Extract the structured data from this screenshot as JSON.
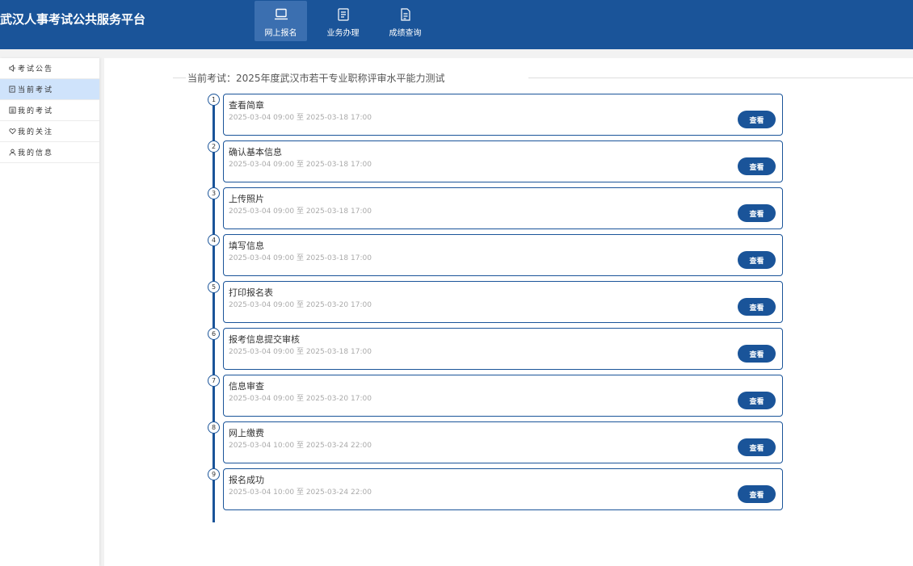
{
  "app": {
    "title": "武汉人事考试公共服务平台"
  },
  "colors": {
    "primary": "#1a5499",
    "nav_active": "#3b6fb0",
    "sidebar_active": "#cfe3fb"
  },
  "nav": [
    {
      "label": "网上报名",
      "icon": "laptop-icon",
      "active": true
    },
    {
      "label": "业务办理",
      "icon": "business-icon",
      "active": false
    },
    {
      "label": "成绩查询",
      "icon": "document-icon",
      "active": false
    }
  ],
  "sidebar": [
    {
      "label": "考试公告",
      "icon": "speaker-icon",
      "active": false
    },
    {
      "label": "当前考试",
      "icon": "edit-icon",
      "active": true
    },
    {
      "label": "我的考试",
      "icon": "list-icon",
      "active": false
    },
    {
      "label": "我的关注",
      "icon": "heart-icon",
      "active": false
    },
    {
      "label": "我的信息",
      "icon": "user-icon",
      "active": false
    }
  ],
  "exam": {
    "title": "当前考试：2025年度武汉市若干专业职称评审水平能力测试"
  },
  "steps": [
    {
      "num": "1",
      "name": "查看简章",
      "time": "2025-03-04 09:00 至 2025-03-18 17:00",
      "button": "查看"
    },
    {
      "num": "2",
      "name": "确认基本信息",
      "time": "2025-03-04 09:00 至 2025-03-18 17:00",
      "button": "查看"
    },
    {
      "num": "3",
      "name": "上传照片",
      "time": "2025-03-04 09:00 至 2025-03-18 17:00",
      "button": "查看"
    },
    {
      "num": "4",
      "name": "填写信息",
      "time": "2025-03-04 09:00 至 2025-03-18 17:00",
      "button": "查看"
    },
    {
      "num": "5",
      "name": "打印报名表",
      "time": "2025-03-04 09:00 至 2025-03-20 17:00",
      "button": "查看"
    },
    {
      "num": "6",
      "name": "报考信息提交审核",
      "time": "2025-03-04 09:00 至 2025-03-18 17:00",
      "button": "查看"
    },
    {
      "num": "7",
      "name": "信息审查",
      "time": "2025-03-04 09:00 至 2025-03-20 17:00",
      "button": "查看"
    },
    {
      "num": "8",
      "name": "网上缴费",
      "time": "2025-03-04 10:00 至 2025-03-24 22:00",
      "button": "查看"
    },
    {
      "num": "9",
      "name": "报名成功",
      "time": "2025-03-04 10:00 至 2025-03-24 22:00",
      "button": "查看"
    }
  ]
}
